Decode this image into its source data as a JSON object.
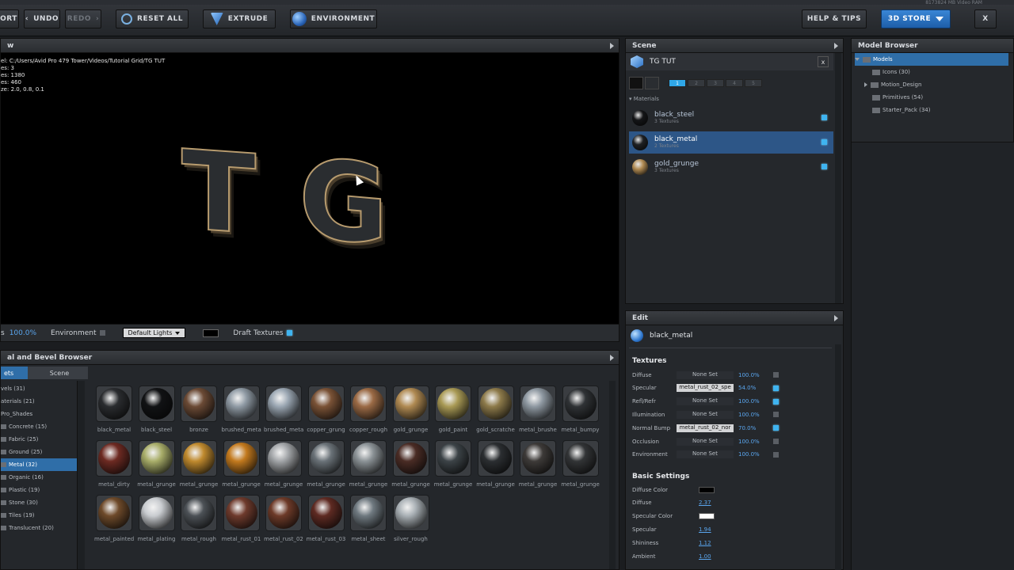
{
  "toolbar": {
    "export_label": "ORT",
    "undo_label": "UNDO",
    "redo_label": "REDO",
    "reset_all_label": "RESET ALL",
    "extrude_label": "EXTRUDE",
    "environment_label": "ENVIRONMENT",
    "help_label": "HELP & TIPS",
    "store_label": "3D STORE",
    "close_label": "X",
    "caption": "8173824 MB Video RAM"
  },
  "viewport": {
    "title": "w",
    "info": [
      "el: C:/Users/Avid Pro 479 Tower/Videos/Tutorial Grid/TG TUT",
      "es: 3",
      "es: 1380",
      "es: 460",
      "ze: 2.0, 0.8, 0.1"
    ],
    "model_text": [
      "T",
      "G"
    ],
    "status": {
      "zoom_label": "s",
      "zoom_value": "100.0%",
      "environment_label": "Environment",
      "lights_value": "Default Lights",
      "draft_label": "Draft Textures"
    }
  },
  "material_browser": {
    "title": "al and Bevel Browser",
    "tabs": [
      "ets",
      "Scene"
    ],
    "tree": [
      {
        "label": "vels (31)",
        "selected": false
      },
      {
        "label": "aterials (21)",
        "selected": false
      },
      {
        "label": "Pro_Shades",
        "selected": false
      },
      {
        "label": "Concrete (15)",
        "selected": false
      },
      {
        "label": "Fabric (25)",
        "selected": false
      },
      {
        "label": "Ground (25)",
        "selected": false
      },
      {
        "label": "Metal (32)",
        "selected": true
      },
      {
        "label": "Organic (16)",
        "selected": false
      },
      {
        "label": "Plastic (19)",
        "selected": false
      },
      {
        "label": "Stone (30)",
        "selected": false
      },
      {
        "label": "Tiles (19)",
        "selected": false
      },
      {
        "label": "Translucent (20)",
        "selected": false
      }
    ],
    "materials": [
      {
        "name": "black_metal",
        "color": "#2a2c2f"
      },
      {
        "name": "black_steel",
        "color": "#111214"
      },
      {
        "name": "bronze",
        "color": "#6b4a35"
      },
      {
        "name": "brushed_meta",
        "color": "#8f9aa4"
      },
      {
        "name": "brushed_meta",
        "color": "#9aa6b2"
      },
      {
        "name": "copper_grung",
        "color": "#7a5236"
      },
      {
        "name": "copper_rough",
        "color": "#9b6a45"
      },
      {
        "name": "gold_grunge",
        "color": "#b08a52"
      },
      {
        "name": "gold_paint",
        "color": "#a99a55"
      },
      {
        "name": "gold_scratche",
        "color": "#8d7a4a"
      },
      {
        "name": "metal_brushe",
        "color": "#8e98a1"
      },
      {
        "name": "metal_bumpy",
        "color": "#2f3235"
      },
      {
        "name": "metal_dirty",
        "color": "#6d2a22"
      },
      {
        "name": "metal_grunge",
        "color": "#a9ae6a"
      },
      {
        "name": "metal_grunge",
        "color": "#c08a2e"
      },
      {
        "name": "metal_grunge",
        "color": "#c37a1e"
      },
      {
        "name": "metal_grunge",
        "color": "#a2a5a8"
      },
      {
        "name": "metal_grunge",
        "color": "#6a7278"
      },
      {
        "name": "metal_grunge",
        "color": "#8b9296"
      },
      {
        "name": "metal_grunge",
        "color": "#4a2c25"
      },
      {
        "name": "metal_grunge",
        "color": "#3c4347"
      },
      {
        "name": "metal_grunge",
        "color": "#2b2e31"
      },
      {
        "name": "metal_grunge",
        "color": "#3d3a38"
      },
      {
        "name": "metal_grunge",
        "color": "#323436"
      },
      {
        "name": "metal_painted",
        "color": "#6e4a2a"
      },
      {
        "name": "metal_plating",
        "color": "#c9ccd0"
      },
      {
        "name": "metal_rough",
        "color": "#4c5156"
      },
      {
        "name": "metal_rust_01",
        "color": "#6e3a2c"
      },
      {
        "name": "metal_rust_02",
        "color": "#6d3a28"
      },
      {
        "name": "metal_rust_03",
        "color": "#5e2a22"
      },
      {
        "name": "metal_sheet",
        "color": "#6f7980"
      },
      {
        "name": "silver_rough",
        "color": "#a9b0b5"
      }
    ]
  },
  "scene": {
    "title": "Scene",
    "object_name": "TG TUT",
    "close_label": "x",
    "pages": [
      "1",
      "2",
      "3",
      "4",
      "5"
    ],
    "materials_header": "Materials",
    "materials": [
      {
        "name": "black_steel",
        "sub": "3 Textures",
        "color": "#141517",
        "selected": false
      },
      {
        "name": "black_metal",
        "sub": "2 Textures",
        "color": "#1e2023",
        "selected": true
      },
      {
        "name": "gold_grunge",
        "sub": "3 Textures",
        "color": "#b08a52",
        "selected": false
      }
    ]
  },
  "model_browser": {
    "title": "Model Browser",
    "items": [
      {
        "label": "Models",
        "indent": 0,
        "selected": true,
        "expand": "down"
      },
      {
        "label": "Icons (30)",
        "indent": 1,
        "selected": false,
        "expand": "none"
      },
      {
        "label": "Motion_Design",
        "indent": 1,
        "selected": false,
        "expand": "right"
      },
      {
        "label": "Primitives (54)",
        "indent": 1,
        "selected": false,
        "expand": "none"
      },
      {
        "label": "Starter_Pack (34)",
        "indent": 1,
        "selected": false,
        "expand": "none"
      }
    ]
  },
  "edit": {
    "title": "Edit",
    "material_name": "black_metal",
    "textures_header": "Textures",
    "textures": [
      {
        "label": "Diffuse",
        "texture": "None Set",
        "value": "100.0%",
        "enabled": false
      },
      {
        "label": "Specular",
        "texture": "metal_rust_02_spe",
        "value": "54.0%",
        "enabled": true
      },
      {
        "label": "Refl/Refr",
        "texture": "None Set",
        "value": "100.0%",
        "enabled": true
      },
      {
        "label": "Illumination",
        "texture": "None Set",
        "value": "100.0%",
        "enabled": false
      },
      {
        "label": "Normal Bump",
        "texture": "metal_rust_02_nor",
        "value": "70.0%",
        "enabled": true
      },
      {
        "label": "Occlusion",
        "texture": "None Set",
        "value": "100.0%",
        "enabled": false
      },
      {
        "label": "Environment",
        "texture": "None Set",
        "value": "100.0%",
        "enabled": false
      }
    ],
    "basic_header": "Basic Settings",
    "basic": [
      {
        "label": "Diffuse Color",
        "value": "",
        "swatch": "#000000"
      },
      {
        "label": "Diffuse",
        "value": "2.37",
        "swatch": ""
      },
      {
        "label": "Specular Color",
        "value": "",
        "swatch": "#ffffff"
      },
      {
        "label": "Specular",
        "value": "1.94",
        "swatch": ""
      },
      {
        "label": "Shininess",
        "value": "1.12",
        "swatch": ""
      },
      {
        "label": "Ambient",
        "value": "1.00",
        "swatch": ""
      }
    ]
  }
}
